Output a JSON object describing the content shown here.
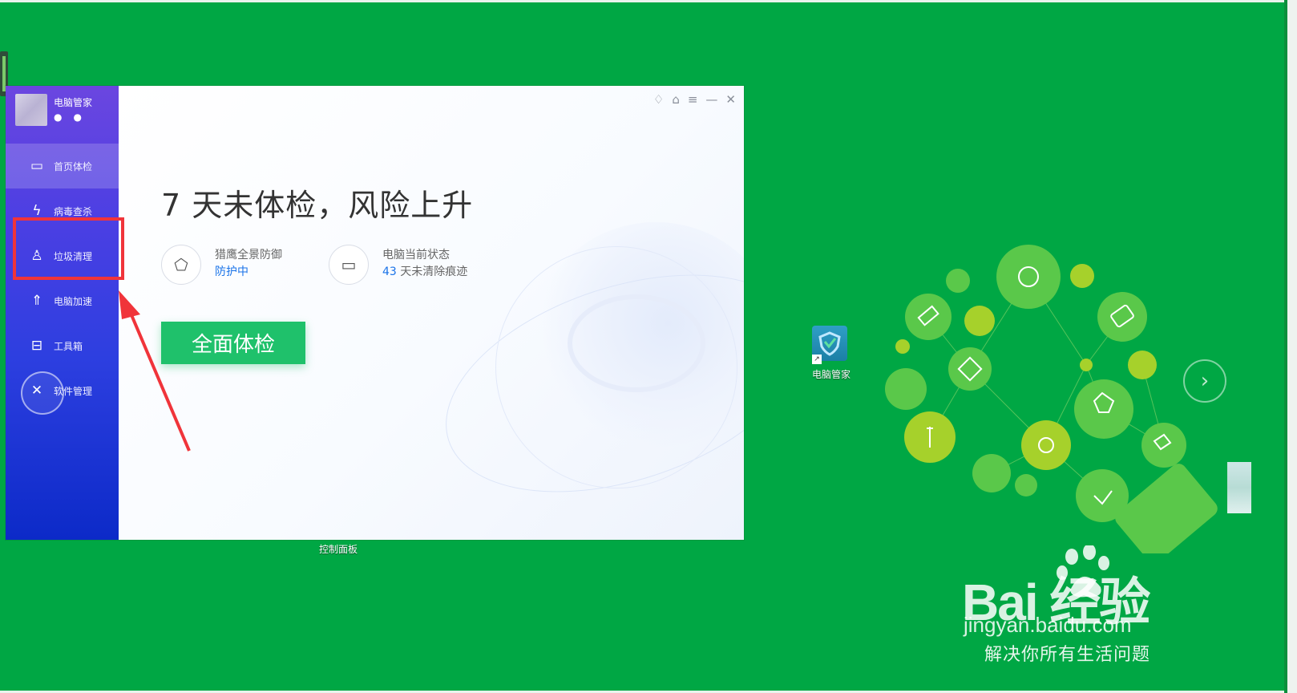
{
  "app": {
    "brand_name": "电脑管家",
    "brand_icons": [
      "shield-badge",
      "shield-badge"
    ],
    "window_controls": [
      "leaf-icon",
      "shirt-icon",
      "menu-icon",
      "minimize-icon",
      "close-icon"
    ],
    "nav": [
      {
        "label": "首页体检",
        "icon": "monitor-pulse-icon",
        "active": true
      },
      {
        "label": "病毒查杀",
        "icon": "lightning-circle-icon",
        "active": false
      },
      {
        "label": "垃圾清理",
        "icon": "broom-icon",
        "active": false
      },
      {
        "label": "电脑加速",
        "icon": "rocket-icon",
        "active": false
      },
      {
        "label": "工具箱",
        "icon": "toolbox-icon",
        "active": false
      },
      {
        "label": "软件管理",
        "icon": "software-icon",
        "active": false
      }
    ],
    "headline": "7 天未体检，风险上升",
    "status": {
      "protection_title": "猎鹰全景防御",
      "protection_value": "防护中",
      "pc_title": "电脑当前状态",
      "pc_value_num": "43",
      "pc_value_text": " 天未清除痕迹"
    },
    "scan_button": "全面体检"
  },
  "desktop": {
    "control_panel_label": "控制面板",
    "shortcut_label": "电脑管家",
    "next_glyph": "›"
  },
  "watermark": {
    "brand": "Bai  经验",
    "url": "jingyan.baidu.com",
    "slogan": "解决你所有生活问题"
  },
  "colors": {
    "desktop_bg": "#00a744",
    "highlight": "#f0343a",
    "scan_button": "#1fc16b",
    "accent_blue": "#1a73e8"
  }
}
